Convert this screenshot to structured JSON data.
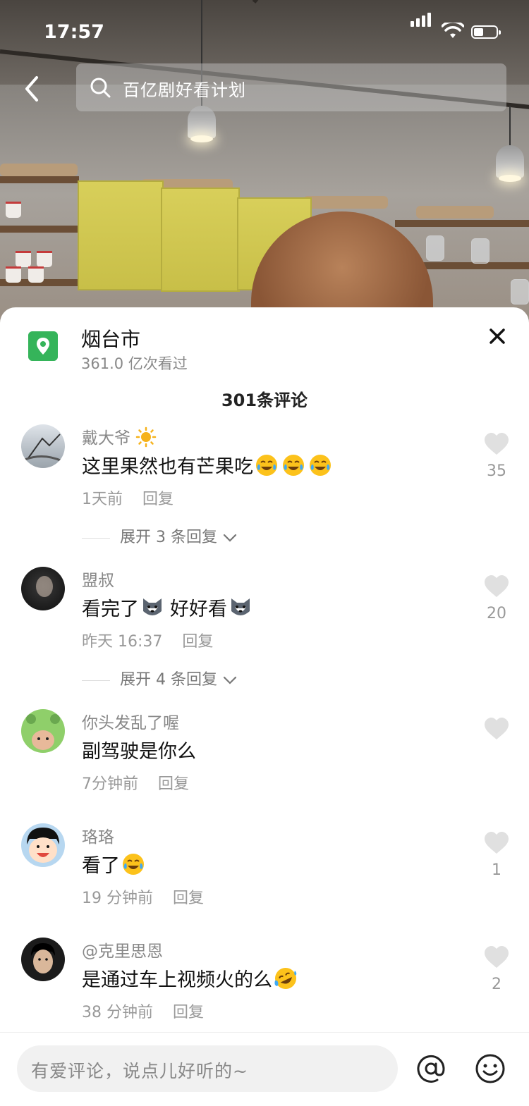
{
  "status_bar": {
    "time": "17:57"
  },
  "search": {
    "query": "百亿剧好看计划"
  },
  "location": {
    "name": "烟台市",
    "views": "361.0 亿次看过"
  },
  "comments_header": {
    "count_label": "301条评论"
  },
  "comments": [
    {
      "name": "戴大爷",
      "name_icon": "sun-icon",
      "text": "这里果然也有芒果吃",
      "emojis": [
        "laugh-cry-icon",
        "laugh-cry-icon",
        "laugh-cry-icon"
      ],
      "time": "1天前",
      "reply": "回复",
      "likes": "35",
      "expand": "展开 3 条回复"
    },
    {
      "name": "盟叔",
      "text": "看完了",
      "text2": "好好看",
      "emojis": [
        "husky-icon"
      ],
      "time": "昨天 16:37",
      "reply": "回复",
      "likes": "20",
      "expand": "展开 4 条回复"
    },
    {
      "name": "你头发乱了喔",
      "text": "副驾驶是你么",
      "time": "7分钟前",
      "reply": "回复",
      "likes": ""
    },
    {
      "name": "珞珞",
      "text": "看了",
      "emojis": [
        "laugh-cry-icon"
      ],
      "time": "19 分钟前",
      "reply": "回复",
      "likes": "1"
    },
    {
      "name": "@克里思恩",
      "text": "是通过车上视频火的么",
      "emojis": [
        "rofl-icon"
      ],
      "time": "38 分钟前",
      "reply": "回复",
      "likes": "2"
    }
  ],
  "input": {
    "placeholder": "有爱评论，说点儿好听的~"
  },
  "colors": {
    "location_green": "#35b45a",
    "muted": "#999999"
  }
}
